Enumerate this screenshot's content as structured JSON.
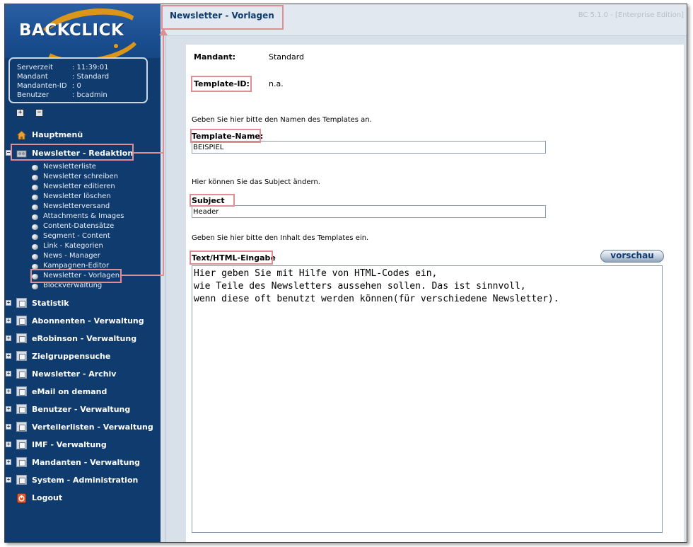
{
  "app": {
    "logo": "BACKCLICK",
    "version": "BC 5.1.0 - [Enterprise Edition]"
  },
  "info": {
    "rows": [
      {
        "key": "Serverzeit",
        "value": ": 11:39:01"
      },
      {
        "key": "Mandant",
        "value": ": Standard"
      },
      {
        "key": "Mandanten-ID",
        "value": ": 0"
      },
      {
        "key": "Benutzer",
        "value": ": bcadmin"
      }
    ]
  },
  "tree_buttons": {
    "expand": "+",
    "collapse": "−"
  },
  "menu": {
    "home": "Hauptmenü",
    "redaktion": "Newsletter - Redaktion",
    "sub_items": [
      "Newsletterliste",
      "Newsletter schreiben",
      "Newsletter editieren",
      "Newsletter löschen",
      "Newsletterversand",
      "Attachments & Images",
      "Content-Datensätze",
      "Segment - Content",
      "Link - Kategorien",
      "News - Manager",
      "Kampagnen-Editor",
      "Newsletter - Vorlagen",
      "Blockverwaltung"
    ],
    "sections": [
      "Statistik",
      "Abonnenten - Verwaltung",
      "eRobinson - Verwaltung",
      "Zielgruppensuche",
      "Newsletter - Archiv",
      "eMail on demand",
      "Benutzer - Verwaltung",
      "Verteilerlisten - Verwaltung",
      "IMF - Verwaltung",
      "Mandanten - Verwaltung",
      "System - Administration"
    ],
    "logout": "Logout"
  },
  "page": {
    "title": "Newsletter - Vorlagen"
  },
  "form": {
    "mandant_label": "Mandant:",
    "mandant_value": "Standard",
    "template_id_label": "Template-ID:",
    "template_id_value": "n.a.",
    "name_hint": "Geben Sie hier bitte den Namen des Templates an.",
    "name_label": "Template-Name:",
    "name_value": "BEISPIEL",
    "subject_hint": "Hier können Sie das Subject ändern.",
    "subject_label": "Subject",
    "subject_value": "Header",
    "content_hint": "Geben Sie hier bitte den Inhalt des Templates ein.",
    "content_label": "Text/HTML-Eingabe",
    "preview_button": "vorschau",
    "content_value": "Hier geben Sie mit Hilfe von HTML-Codes ein,\nwie Teile des Newsletters aussehen sollen. Das ist sinnvoll,\nwenn diese oft benutzt werden können(für verschiedene Newsletter)."
  },
  "colors": {
    "sidebar": "#0f3b6e",
    "highlight": "#e08d93",
    "accent": "#e59a12",
    "content_bg": "#d8e1ea"
  }
}
